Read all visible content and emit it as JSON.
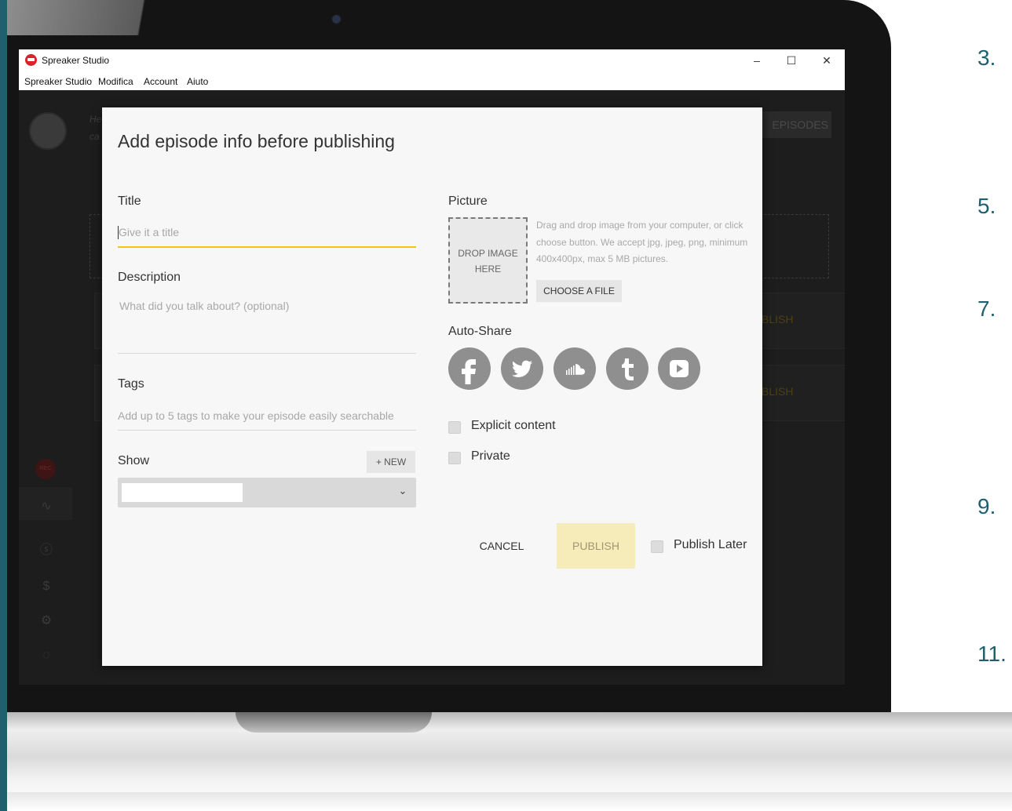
{
  "steps": [
    "3.",
    "5.",
    "7.",
    "9.",
    "11."
  ],
  "window": {
    "title": "Spreaker Studio",
    "controls": {
      "minimize": "–",
      "maximize": "☐",
      "close": "✕"
    },
    "menu": [
      "Spreaker Studio",
      "Modifica",
      "Account",
      "Aiuto"
    ]
  },
  "background": {
    "episodes_button": "EPISODES",
    "publish_labels": [
      "BLISH",
      "BLISH"
    ],
    "rec_label": "REC",
    "header_text": [
      "He",
      "ca"
    ]
  },
  "modal": {
    "title": "Add episode info before publishing",
    "title_field": {
      "label": "Title",
      "placeholder": "Give it a title"
    },
    "description_field": {
      "label": "Description",
      "placeholder": "What did you talk about? (optional)"
    },
    "tags_field": {
      "label": "Tags",
      "placeholder": "Add up to 5 tags to make your episode easily searchable"
    },
    "show_field": {
      "label": "Show",
      "new_button": "+ NEW",
      "selected": ""
    },
    "picture": {
      "label": "Picture",
      "drop_zone_line1": "DROP IMAGE",
      "drop_zone_line2": "HERE",
      "help": "Drag and drop image from your computer, or click choose button. We accept jpg, jpeg, png, minimum 400x400px, max 5 MB pictures.",
      "choose_button": "CHOOSE A FILE"
    },
    "auto_share": {
      "label": "Auto-Share",
      "networks": [
        "facebook-icon",
        "twitter-icon",
        "soundcloud-icon",
        "tumblr-icon",
        "youtube-icon"
      ],
      "color": "#8f8f8f"
    },
    "explicit_content": {
      "label": "Explicit content",
      "checked": false
    },
    "private": {
      "label": "Private",
      "checked": false
    },
    "cancel_button": "CANCEL",
    "publish_button": "PUBLISH",
    "publish_later": {
      "label": "Publish Later",
      "checked": false
    },
    "accent_color": "#f0c419"
  }
}
